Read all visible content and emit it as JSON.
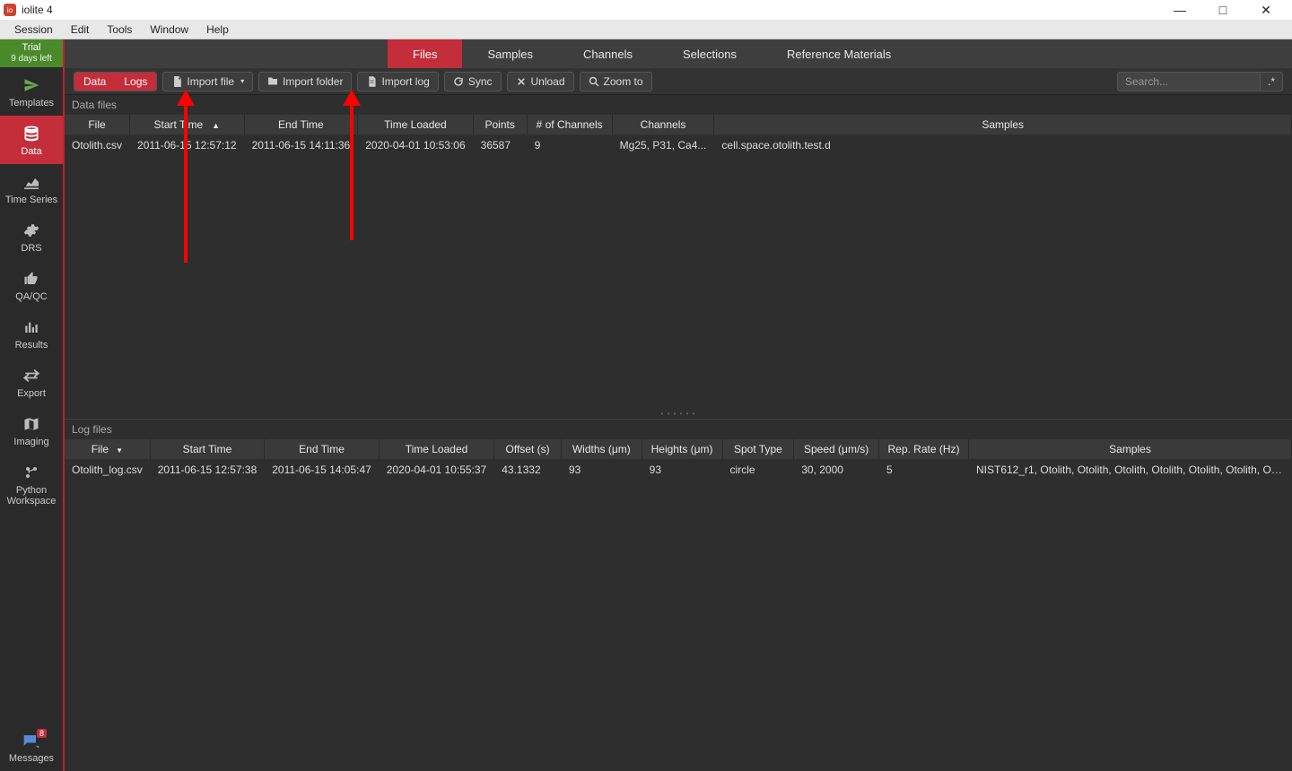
{
  "window": {
    "title": "iolite 4",
    "min": "—",
    "max": "□",
    "close": "✕"
  },
  "menubar": [
    "Session",
    "Edit",
    "Tools",
    "Window",
    "Help"
  ],
  "trial": {
    "label": "Trial",
    "sub": "9 days left"
  },
  "sidebar": [
    {
      "label": "Templates"
    },
    {
      "label": "Data"
    },
    {
      "label": "Time Series"
    },
    {
      "label": "DRS"
    },
    {
      "label": "QA/QC"
    },
    {
      "label": "Results"
    },
    {
      "label": "Export"
    },
    {
      "label": "Imaging"
    },
    {
      "label": "Python Workspace"
    }
  ],
  "sidebar_bottom": {
    "label": "Messages",
    "badge": "8"
  },
  "top_tabs": [
    "Files",
    "Samples",
    "Channels",
    "Selections",
    "Reference Materials"
  ],
  "toolbar": {
    "seg_data": "Data",
    "seg_logs": "Logs",
    "import_file": "Import file",
    "import_folder": "Import folder",
    "import_log": "Import log",
    "sync": "Sync",
    "unload": "Unload",
    "zoom_to": "Zoom to",
    "search_placeholder": "Search...",
    "search_glyph": ".*"
  },
  "data_files": {
    "label": "Data files",
    "headers": [
      "File",
      "Start Time",
      "End Time",
      "Time Loaded",
      "Points",
      "# of Channels",
      "Channels",
      "Samples"
    ],
    "rows": [
      {
        "file": "Otolith.csv",
        "start": "2011-06-15 12:57:12",
        "end": "2011-06-15 14:11:36",
        "loaded": "2020-04-01 10:53:06",
        "points": "36587",
        "nch": "9",
        "channels": "Mg25, P31, Ca4...",
        "samples": "cell.space.otolith.test.d"
      }
    ]
  },
  "log_files": {
    "label": "Log files",
    "headers": [
      "File",
      "Start Time",
      "End Time",
      "Time Loaded",
      "Offset (s)",
      "Widths (μm)",
      "Heights (μm)",
      "Spot Type",
      "Speed (μm/s)",
      "Rep. Rate (Hz)",
      "Samples"
    ],
    "rows": [
      {
        "file": "Otolith_log.csv",
        "start": "2011-06-15 12:57:38",
        "end": "2011-06-15 14:05:47",
        "loaded": "2020-04-01 10:55:37",
        "offset": "43.1332",
        "widths": "93",
        "heights": "93",
        "spot": "circle",
        "speed": "30, 2000",
        "rep": "5",
        "samples": "NIST612_r1, Otolith, Otolith, Otolith, Otolith, Otolith, Otolith, Otolith, ..."
      }
    ]
  }
}
